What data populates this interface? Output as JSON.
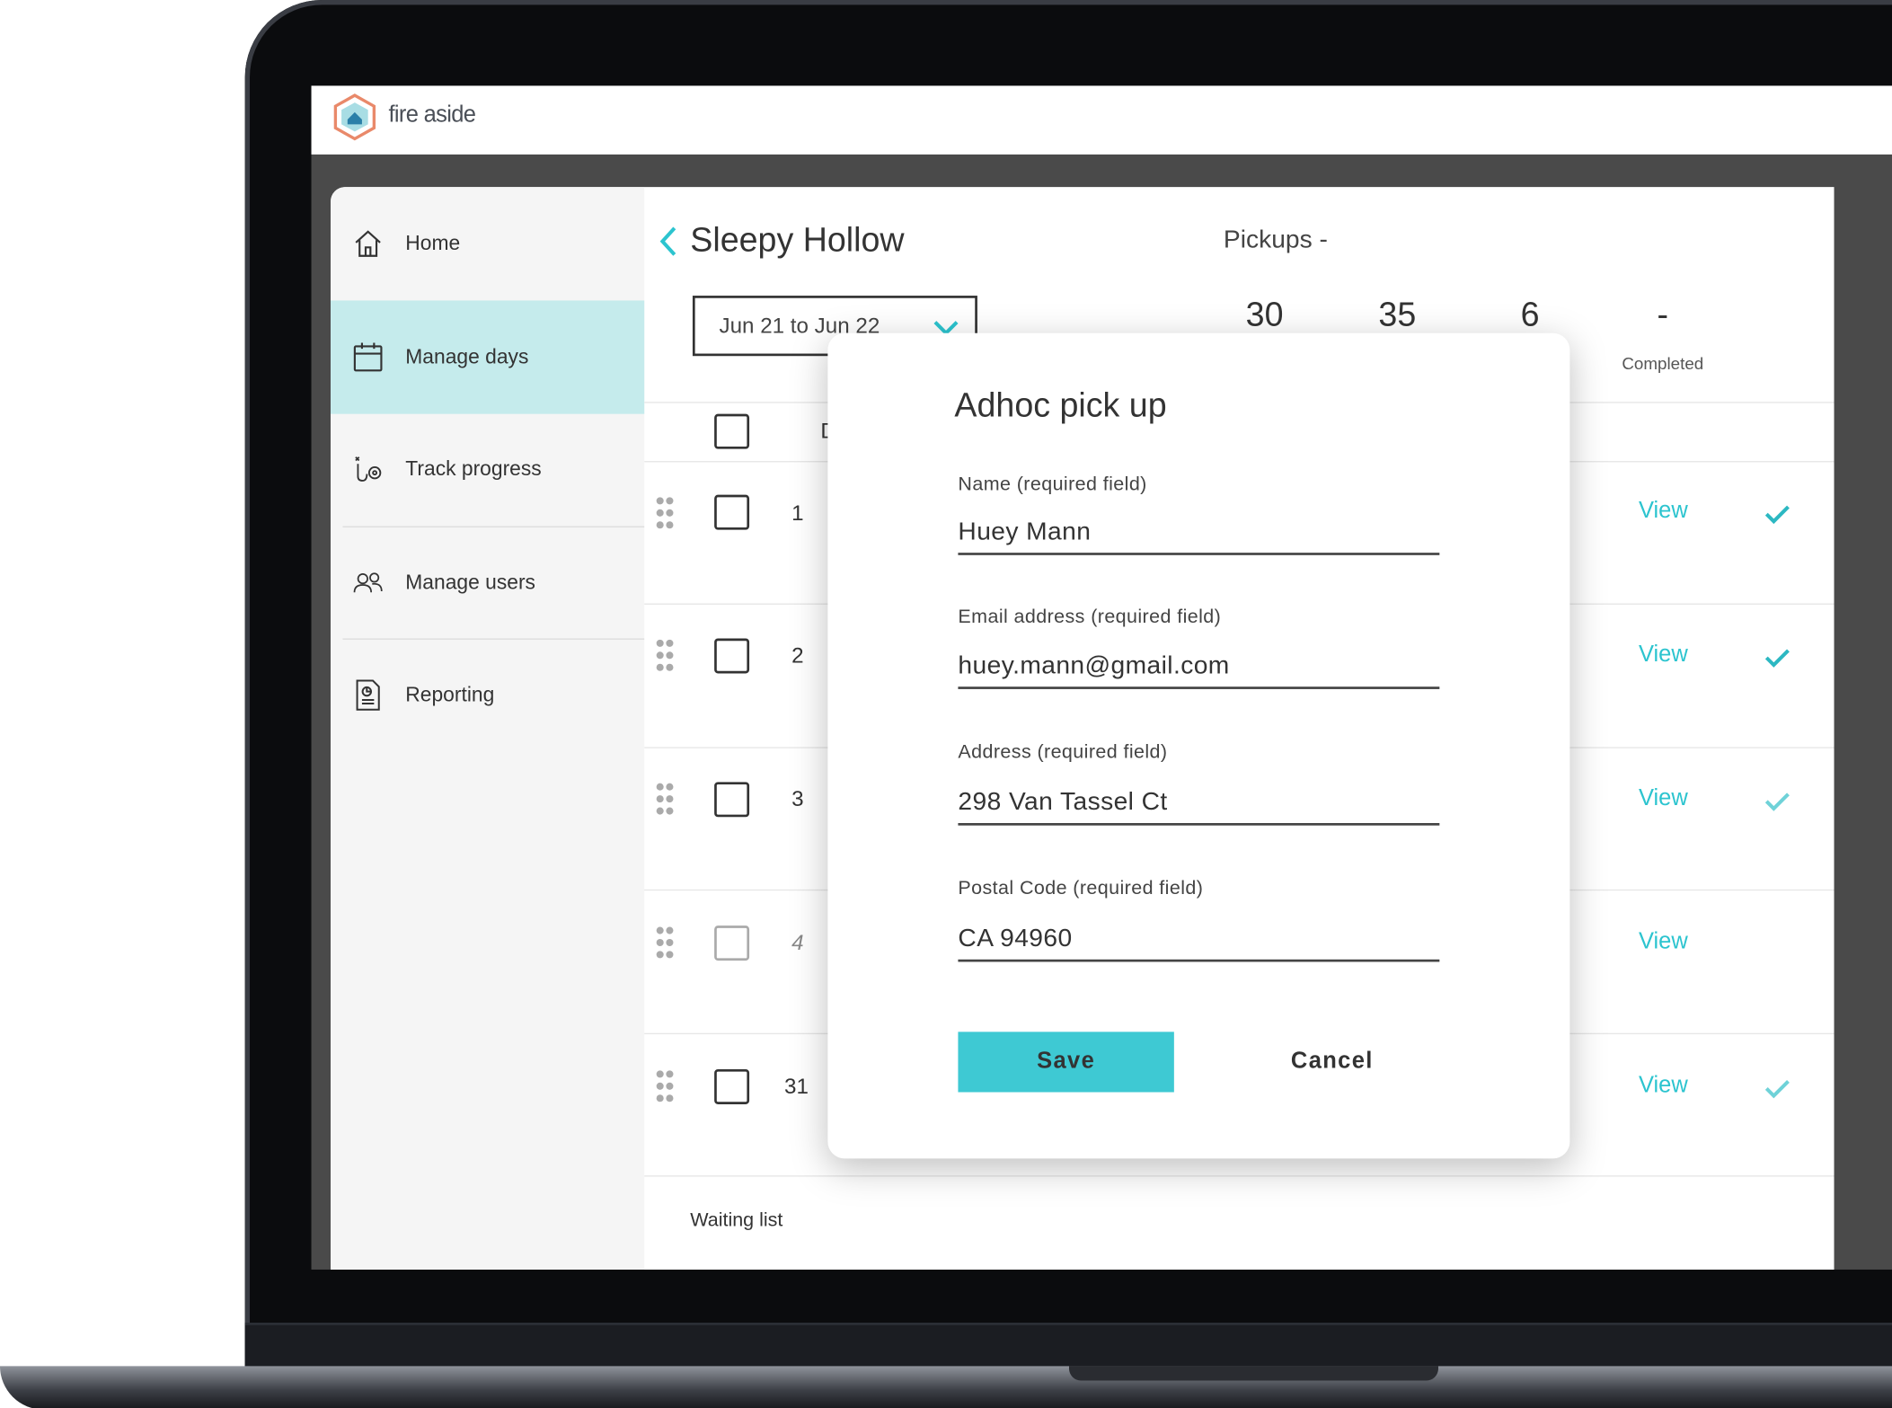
{
  "app": {
    "logo_text": "fire aside"
  },
  "colors": {
    "accent": "#3ec9d3",
    "active_nav": "#c5ebec",
    "link": "#2cc4cf"
  },
  "sidebar": {
    "items": [
      {
        "label": "Home",
        "icon": "home-icon"
      },
      {
        "label": "Manage days",
        "icon": "calendar-icon",
        "active": true
      },
      {
        "label": "Track progress",
        "icon": "route-pin-icon"
      },
      {
        "label": "Manage users",
        "icon": "users-icon"
      },
      {
        "label": "Reporting",
        "icon": "report-icon"
      }
    ]
  },
  "header": {
    "title": "Sleepy Hollow",
    "pickups_label": "Pickups -",
    "date_range": "Jun 21 to Jun 22",
    "stats": [
      "30",
      "35",
      "6",
      "-"
    ],
    "completed_label": "Completed"
  },
  "table": {
    "header_partial": "D",
    "rows": [
      {
        "num": "1",
        "view": "View",
        "done": true
      },
      {
        "num": "2",
        "view": "View",
        "done": true
      },
      {
        "num": "3",
        "view": "View",
        "done": true
      },
      {
        "num": "4",
        "view": "View",
        "done": false
      },
      {
        "num": "31",
        "view": "View",
        "done": true
      }
    ],
    "waiting_list": "Waiting list"
  },
  "modal": {
    "title": "Adhoc pick up",
    "name_label": "Name (required field)",
    "name_value": "Huey Mann",
    "email_label": "Email address (required field)",
    "email_value": "huey.mann@gmail.com",
    "address_label": "Address (required field)",
    "address_value": "298 Van Tassel Ct",
    "postal_label": "Postal Code (required field)",
    "postal_value": "CA 94960",
    "save": "Save",
    "cancel": "Cancel"
  }
}
